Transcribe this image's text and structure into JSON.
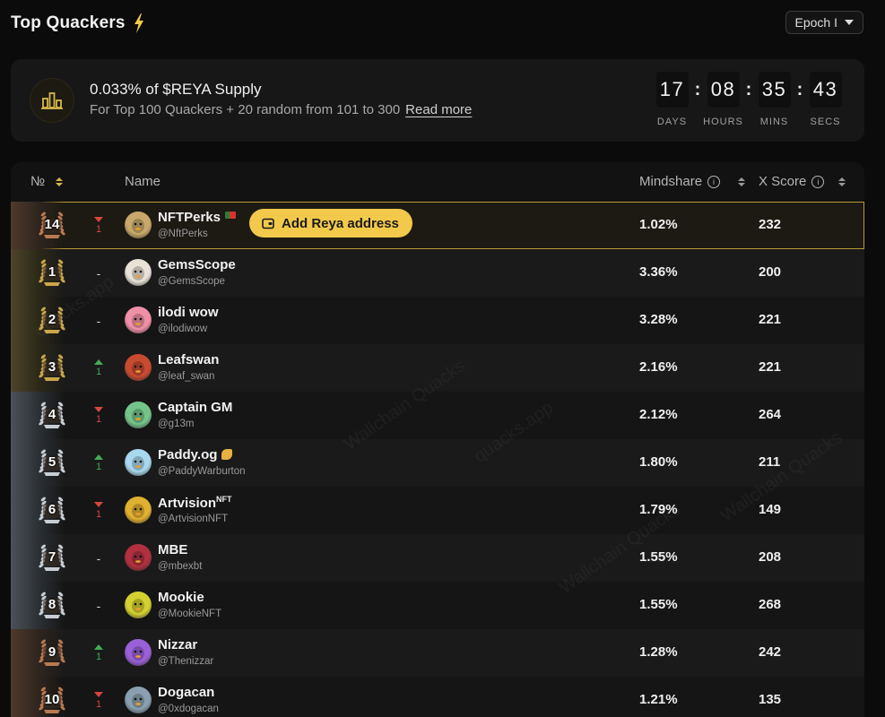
{
  "header": {
    "title": "Top Quackers",
    "epoch_label": "Epoch I"
  },
  "banner": {
    "title": "0.033% of $REYA Supply",
    "subtitle": "For Top 100 Quackers + 20 random from 101 to 300",
    "read_more": "Read more",
    "countdown": [
      {
        "value": "17",
        "label": "DAYS"
      },
      {
        "value": "08",
        "label": "HOURS"
      },
      {
        "value": "35",
        "label": "MINS"
      },
      {
        "value": "43",
        "label": "SECS"
      }
    ]
  },
  "table": {
    "col_rank": "№",
    "col_name": "Name",
    "col_mindshare": "Mindshare",
    "col_xscore": "X Score",
    "add_reya_label": "Add Reya address",
    "rows": [
      {
        "rank": "14",
        "medal": "bronze",
        "move": "down",
        "move_value": "1",
        "name": "NFTPerks",
        "name_suffix": "",
        "handle": "@NftPerks",
        "mindshare": "1.02%",
        "xscore": "232",
        "avatar_color": "#c8a86a",
        "highlight": true
      },
      {
        "rank": "1",
        "medal": "gold",
        "move": "none",
        "move_value": "-",
        "name": "GemsScope",
        "name_suffix": "",
        "handle": "@GemsScope",
        "mindshare": "3.36%",
        "xscore": "200",
        "avatar_color": "#e8e2d6"
      },
      {
        "rank": "2",
        "medal": "gold",
        "move": "none",
        "move_value": "-",
        "name": "ilodi wow",
        "name_suffix": "",
        "handle": "@ilodiwow",
        "mindshare": "3.28%",
        "xscore": "221",
        "avatar_color": "#f08fa8"
      },
      {
        "rank": "3",
        "medal": "gold",
        "move": "up",
        "move_value": "1",
        "name": "Leafswan",
        "name_suffix": "",
        "handle": "@leaf_swan",
        "mindshare": "2.16%",
        "xscore": "221",
        "avatar_color": "#c84a30"
      },
      {
        "rank": "4",
        "medal": "silver",
        "move": "down",
        "move_value": "1",
        "name": "Captain GM",
        "name_suffix": "",
        "handle": "@g13m",
        "mindshare": "2.12%",
        "xscore": "264",
        "avatar_color": "#74c48a"
      },
      {
        "rank": "5",
        "medal": "silver",
        "move": "up",
        "move_value": "1",
        "name": "Paddy.og",
        "name_suffix": "",
        "handle": "@PaddyWarburton",
        "mindshare": "1.80%",
        "xscore": "211",
        "avatar_color": "#a8d8ee"
      },
      {
        "rank": "6",
        "medal": "silver",
        "move": "down",
        "move_value": "1",
        "name": "Artvision",
        "name_suffix": "NFT",
        "handle": "@ArtvisionNFT",
        "mindshare": "1.79%",
        "xscore": "149",
        "avatar_color": "#e0b030"
      },
      {
        "rank": "7",
        "medal": "silver",
        "move": "none",
        "move_value": "-",
        "name": "MBE",
        "name_suffix": "",
        "handle": "@mbexbt",
        "mindshare": "1.55%",
        "xscore": "208",
        "avatar_color": "#b03040"
      },
      {
        "rank": "8",
        "medal": "silver",
        "move": "none",
        "move_value": "-",
        "name": "Mookie",
        "name_suffix": "",
        "handle": "@MookieNFT",
        "mindshare": "1.55%",
        "xscore": "268",
        "avatar_color": "#d4d030"
      },
      {
        "rank": "9",
        "medal": "bronze",
        "move": "up",
        "move_value": "1",
        "name": "Nizzar",
        "name_suffix": "",
        "handle": "@Thenizzar",
        "mindshare": "1.28%",
        "xscore": "242",
        "avatar_color": "#9a60d8"
      },
      {
        "rank": "10",
        "medal": "bronze",
        "move": "down",
        "move_value": "1",
        "name": "Dogacan",
        "name_suffix": "",
        "handle": "@0xdogacan",
        "mindshare": "1.21%",
        "xscore": "135",
        "avatar_color": "#8aa0b0"
      }
    ]
  },
  "watermark": [
    "Wallchain Quacks",
    "quacks.app",
    "Wallchain Quacks",
    "quacks.app",
    "Wallchain Quacks"
  ],
  "colors": {
    "accent": "#f3c94b",
    "gold_border": "#b99a37",
    "up": "#3fae55",
    "down": "#d8453c"
  }
}
